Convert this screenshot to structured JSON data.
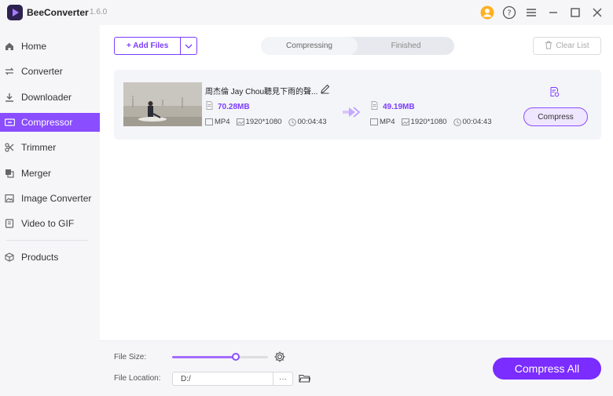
{
  "app": {
    "name": "BeeConverter",
    "version": "1.6.0"
  },
  "sidebar": {
    "items": [
      {
        "label": "Home",
        "icon": "home-icon"
      },
      {
        "label": "Converter",
        "icon": "converter-icon"
      },
      {
        "label": "Downloader",
        "icon": "download-icon"
      },
      {
        "label": "Compressor",
        "icon": "compressor-icon",
        "active": true
      },
      {
        "label": "Trimmer",
        "icon": "scissors-icon"
      },
      {
        "label": "Merger",
        "icon": "merge-icon"
      },
      {
        "label": "Image Converter",
        "icon": "image-icon"
      },
      {
        "label": "Video to GIF",
        "icon": "gif-icon"
      },
      {
        "label": "Products",
        "icon": "box-icon"
      }
    ]
  },
  "toolbar": {
    "add_files": "+ Add Files",
    "tabs": [
      "Compressing",
      "Finished"
    ],
    "clear_list": "Clear List"
  },
  "file": {
    "title": "周杰倫 Jay Chou聽見下雨的聲...",
    "source": {
      "size": "70.28MB",
      "format": "MP4",
      "resolution": "1920*1080",
      "duration": "00:04:43"
    },
    "output": {
      "size": "49.19MB",
      "format": "MP4",
      "resolution": "1920*1080",
      "duration": "00:04:43"
    },
    "compress_label": "Compress"
  },
  "bottom": {
    "file_size_label": "File Size:",
    "file_size_level": 0.66,
    "file_location_label": "File Location:",
    "file_location_value": "D:/",
    "more_label": "···",
    "compress_all": "Compress All"
  },
  "colors": {
    "accent": "#7b2cff",
    "active_nav": "#8a4dff",
    "sidebar_bg": "#f6f6f9"
  }
}
